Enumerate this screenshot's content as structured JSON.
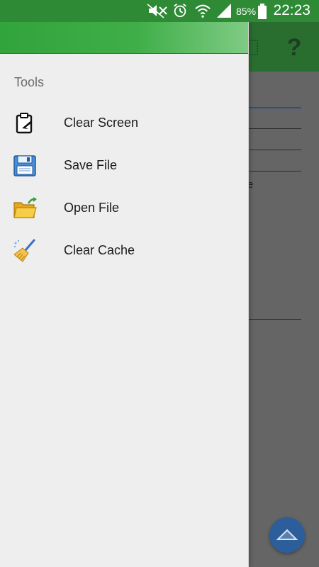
{
  "status_bar": {
    "battery_percent": "85%",
    "time": "22:23"
  },
  "drawer": {
    "section_title": "Tools",
    "items": [
      {
        "label": "Clear Screen",
        "icon": "clipboard-clear-icon"
      },
      {
        "label": "Save File",
        "icon": "floppy-disk-icon"
      },
      {
        "label": "Open File",
        "icon": "open-folder-icon"
      },
      {
        "label": "Clear Cache",
        "icon": "broom-icon"
      }
    ]
  },
  "background_app": {
    "help_glyph": "?",
    "partial_text": "e"
  },
  "colors": {
    "status_bar": "#2f8a36",
    "drawer_header": "#3fae48",
    "drawer_background": "#eeeeee",
    "fab": "#2b5e9a"
  }
}
